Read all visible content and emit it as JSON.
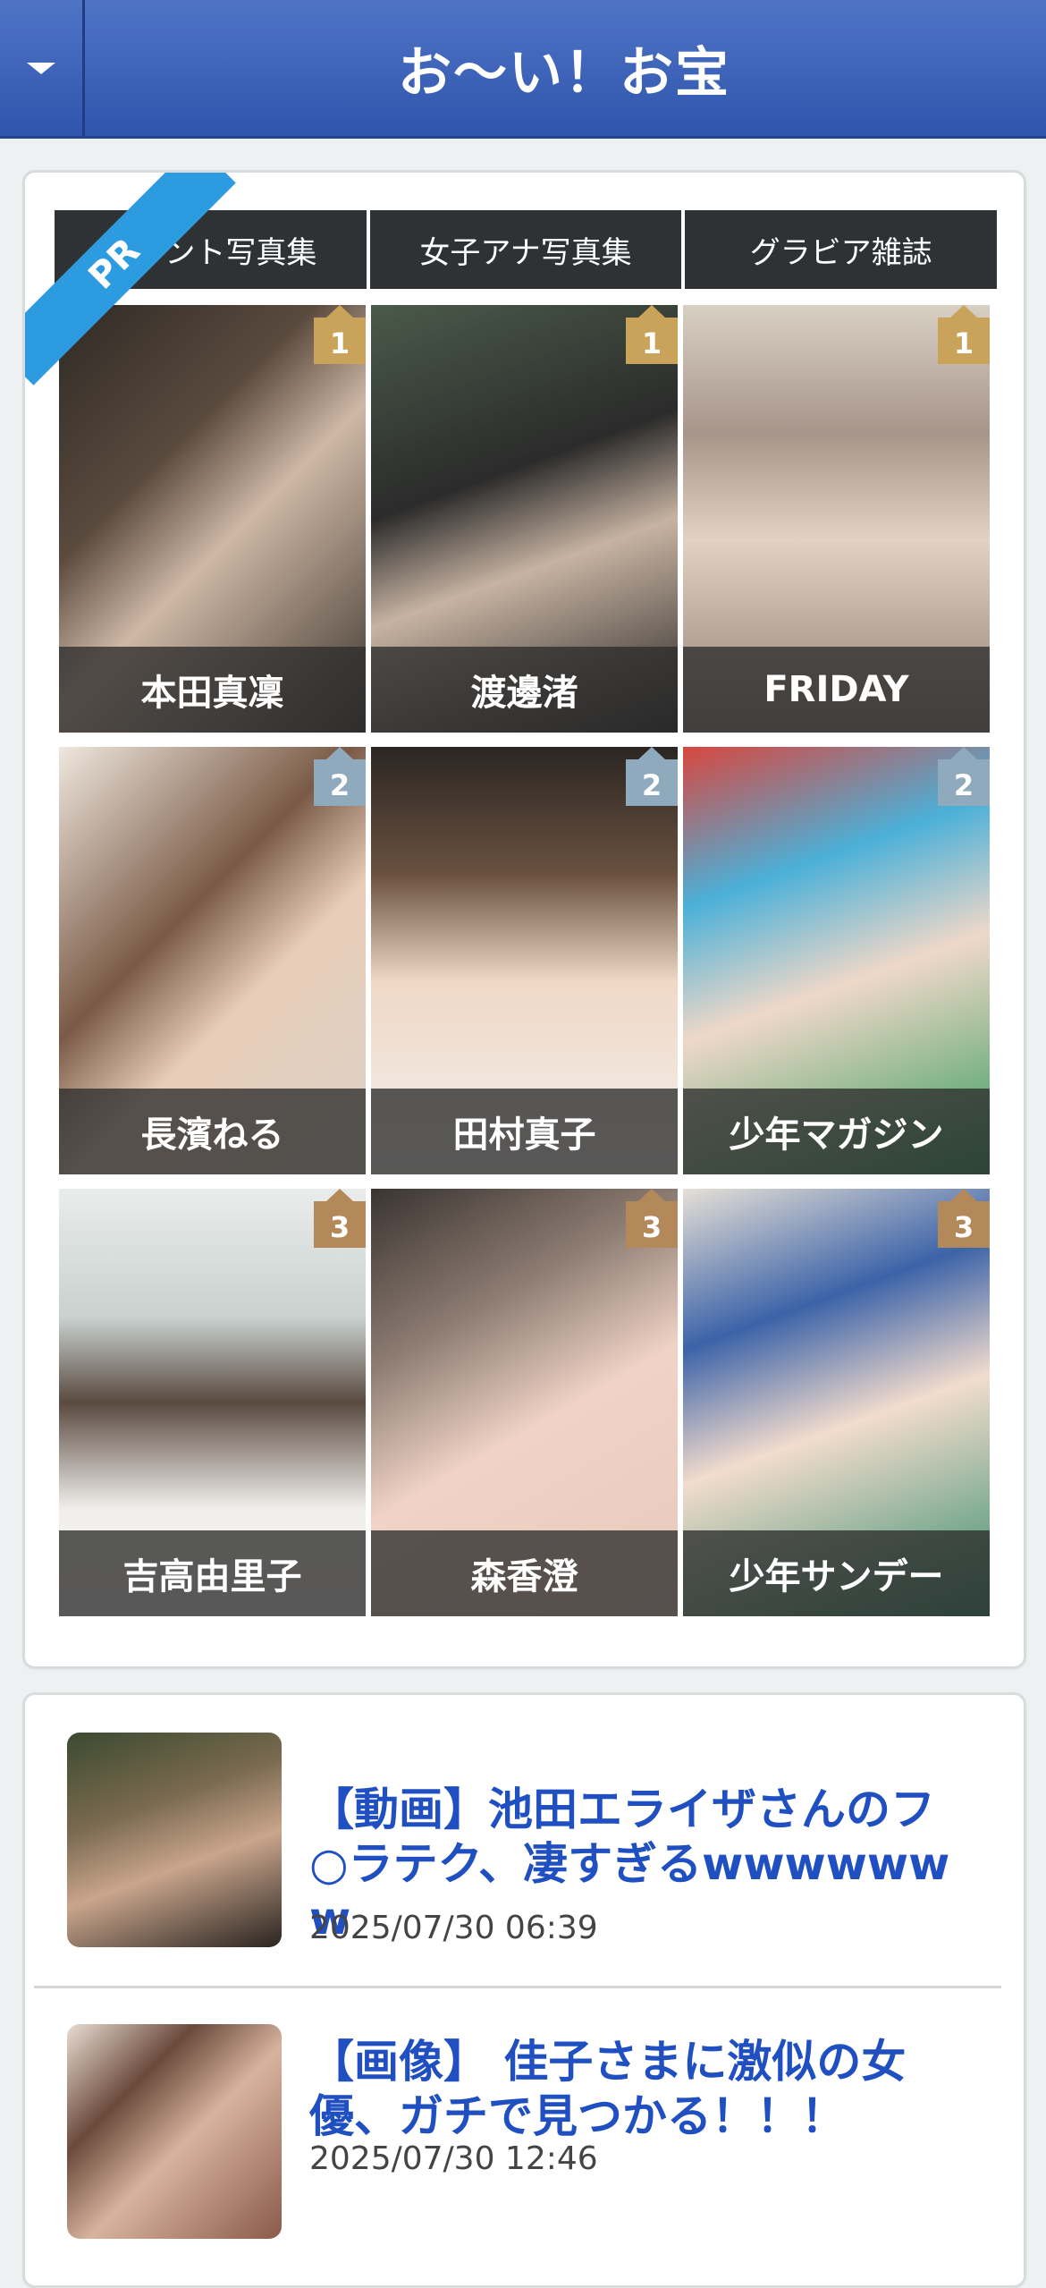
{
  "header": {
    "title": "お〜い！お宝"
  },
  "pr": {
    "badge": "PR",
    "tabs": [
      "タレント写真集",
      "女子アナ写真集",
      "グラビア雑誌"
    ],
    "tiles": [
      {
        "caption": "本田真凜",
        "rank": "1"
      },
      {
        "caption": "渡邊渚",
        "rank": "1"
      },
      {
        "caption": "FRIDAY",
        "rank": "1"
      },
      {
        "caption": "長濱ねる",
        "rank": "2"
      },
      {
        "caption": "田村真子",
        "rank": "2"
      },
      {
        "caption": "少年マガジン",
        "rank": "2"
      },
      {
        "caption": "吉高由里子",
        "rank": "3"
      },
      {
        "caption": "森香澄",
        "rank": "3"
      },
      {
        "caption": "少年サンデー",
        "rank": "3"
      }
    ],
    "rank_colors": {
      "1": "#c9a35a",
      "2": "#8fa9bd",
      "3": "#b3895a"
    }
  },
  "news": [
    {
      "title_lines": [
        "【動画】池田エライザさんのフ",
        "○ラテク、凄すぎるwwwwww",
        "w"
      ],
      "date": "2025/07/30 06:39"
    },
    {
      "title_lines": [
        "【画像】 佳子さまに激似の女",
        "優、ガチで見つかる！！！"
      ],
      "date": "2025/07/30 12:46"
    }
  ]
}
